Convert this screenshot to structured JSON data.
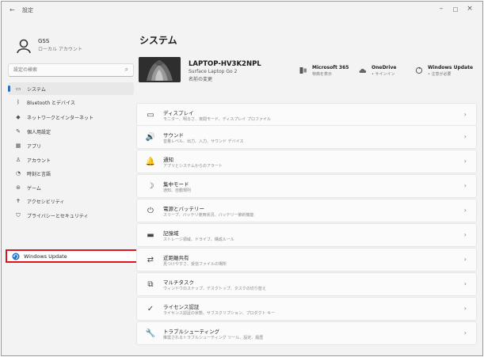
{
  "window": {
    "back_glyph": "←",
    "title": "設定",
    "minimize": "–",
    "maximize": "□",
    "close": "×"
  },
  "user": {
    "name": "GSS",
    "account_type": "ローカル アカウント"
  },
  "search": {
    "placeholder": "設定の検索",
    "icon": "search-icon"
  },
  "nav": {
    "items": [
      {
        "label": "システム",
        "icon": "monitor-icon",
        "glyph": "▭",
        "active": true
      },
      {
        "label": "Bluetooth とデバイス",
        "icon": "bluetooth-icon",
        "glyph": "ᛒ"
      },
      {
        "label": "ネットワークとインターネット",
        "icon": "wifi-icon",
        "glyph": "◆"
      },
      {
        "label": "個人用設定",
        "icon": "brush-icon",
        "glyph": "✎"
      },
      {
        "label": "アプリ",
        "icon": "apps-icon",
        "glyph": "▦"
      },
      {
        "label": "アカウント",
        "icon": "person-icon",
        "glyph": "♙"
      },
      {
        "label": "時刻と言語",
        "icon": "clock-globe-icon",
        "glyph": "◔"
      },
      {
        "label": "ゲーム",
        "icon": "gamepad-icon",
        "glyph": "⊛"
      },
      {
        "label": "アクセシビリティ",
        "icon": "accessibility-icon",
        "glyph": "✝"
      },
      {
        "label": "プライバシーとセキュリティ",
        "icon": "shield-icon",
        "glyph": "⛉"
      }
    ],
    "windows_update": {
      "label": "Windows Update",
      "icon": "windows-update-icon"
    }
  },
  "main": {
    "title": "システム",
    "device": {
      "name": "LAPTOP-HV3K2NPL",
      "model": "Surface Laptop Go 2",
      "rename": "名前の変更"
    },
    "quick": [
      {
        "title": "Microsoft 365",
        "sub": "特典を表示",
        "icon": "microsoft-365-icon"
      },
      {
        "title": "OneDrive",
        "sub": "• サインイン",
        "icon": "onedrive-cloud-icon"
      },
      {
        "title": "Windows Update",
        "sub": "• 注意が必要",
        "icon": "windows-update-icon"
      }
    ],
    "cards": [
      {
        "title": "ディスプレイ",
        "sub": "モニター、明るさ、夜間モード、ディスプレイ プロファイル",
        "icon": "display-icon",
        "glyph": "▭"
      },
      {
        "title": "サウンド",
        "sub": "音量レベル、出力、入力、サウンド デバイス",
        "icon": "speaker-icon",
        "glyph": "🔊"
      },
      {
        "title": "通知",
        "sub": "アプリとシステムからのアラート",
        "icon": "bell-icon",
        "glyph": "🔔"
      },
      {
        "title": "集中モード",
        "sub": "通知、自動規則",
        "icon": "moon-icon",
        "glyph": "☽"
      },
      {
        "title": "電源とバッテリー",
        "sub": "スリープ、バッテリ使用状況、バッテリー節約機能",
        "icon": "power-icon",
        "glyph": "⏻"
      },
      {
        "title": "記憶域",
        "sub": "ストレージ領域、ドライブ、構成ルール",
        "icon": "storage-icon",
        "glyph": "▬"
      },
      {
        "title": "近距離共有",
        "sub": "見つけやすさ、受信ファイルの場所",
        "icon": "nearby-share-icon",
        "glyph": "⇄"
      },
      {
        "title": "マルチタスク",
        "sub": "ウィンドウのスナップ、デスクトップ、タスクの切り替え",
        "icon": "multitasking-icon",
        "glyph": "⧉"
      },
      {
        "title": "ライセンス認証",
        "sub": "ライセンス認証の状態、サブスクリプション、プロダクト キー",
        "icon": "check-circle-icon",
        "glyph": "✓"
      },
      {
        "title": "トラブルシューティング",
        "sub": "推奨されるトラブルシューティング ツール、設定、履歴",
        "icon": "wrench-icon",
        "glyph": "🔧"
      }
    ],
    "chevron": "›"
  },
  "colors": {
    "accent": "#2a6fb8",
    "highlight": "#e0141e",
    "window_bg": "#f3f3f3",
    "card_bg": "#fbfbfb"
  }
}
